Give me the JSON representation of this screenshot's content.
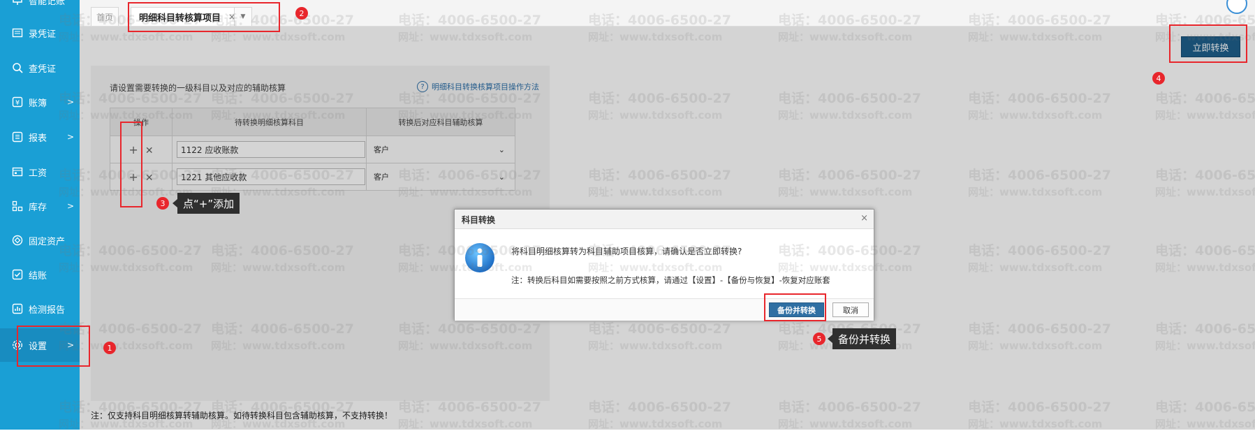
{
  "sidebar": {
    "top_item": "智能记账",
    "items": [
      {
        "label": "录凭证",
        "icon": "voucher-entry-icon",
        "arrow": ""
      },
      {
        "label": "查凭证",
        "icon": "search-icon",
        "arrow": ""
      },
      {
        "label": "账簿",
        "icon": "yen-book-icon",
        "arrow": ">"
      },
      {
        "label": "报表",
        "icon": "report-icon",
        "arrow": ">"
      },
      {
        "label": "工资",
        "icon": "salary-icon",
        "arrow": ""
      },
      {
        "label": "库存",
        "icon": "inventory-icon",
        "arrow": ">"
      },
      {
        "label": "固定资产",
        "icon": "fixed-assets-icon",
        "arrow": ""
      },
      {
        "label": "结账",
        "icon": "checkout-icon",
        "arrow": ""
      },
      {
        "label": "检测报告",
        "icon": "check-report-icon",
        "arrow": ""
      },
      {
        "label": "设置",
        "icon": "gear-icon",
        "arrow": ">"
      }
    ]
  },
  "tabs": {
    "home": "首页",
    "active": "明细科目转核算项目",
    "close": "×",
    "more": "▼"
  },
  "toolbar": {
    "convert_now": "立即转换"
  },
  "content": {
    "instruction": "请设置需要转换的一级科目以及对应的辅助核算",
    "help_link": "明细科目转换核算项目操作方法",
    "help_icon": "?",
    "table": {
      "headers": [
        "操作",
        "待转换明细核算科目",
        "转换后对应科目辅助核算"
      ],
      "rows": [
        {
          "subject": "1122 应收账款",
          "aux": "客户"
        },
        {
          "subject": "1221 其他应收款",
          "aux": "客户"
        }
      ],
      "add_symbol": "+",
      "remove_symbol": "✕",
      "dropdown_arrow": "⌄"
    },
    "note": "注：仅支持科目明细核算转辅助核算。如待转换科目包含辅助核算，不支持转换！"
  },
  "dialog": {
    "title": "科目转换",
    "close": "×",
    "message": "将科目明细核算转为科目辅助项目核算，请确认是否立即转换?",
    "sub_message": "注：转换后科目如需要按照之前方式核算，请通过【设置】-【备份与恢复】-恢复对应账套",
    "backup_button": "备份并转换",
    "cancel_button": "取消"
  },
  "annotations": {
    "badges": [
      "1",
      "2",
      "3",
      "4",
      "5"
    ],
    "callout_add": "点“+”添加",
    "callout_backup": "备份并转换",
    "accent_color": "#e8262c"
  },
  "watermark": {
    "phone": "电话：4006-6500-27",
    "site": "网址：www.tdxsoft.com"
  },
  "colors": {
    "sidebar": "#1a9fd5",
    "primary_button": "#1f5f8c"
  }
}
